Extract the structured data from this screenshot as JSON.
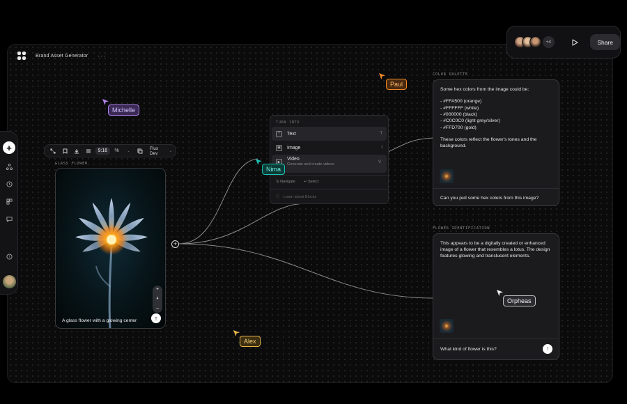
{
  "app": {
    "title": "Brand Asset Generator",
    "more": "···"
  },
  "share_bar": {
    "extra_count": "+4",
    "share_label": "Share"
  },
  "toolbar": {
    "aspect_ratio": "9:16",
    "percent_symbol": "%",
    "model": "Flux Dev"
  },
  "flower_node": {
    "label": "GLASS FLOWER",
    "caption": "A glass flower with a glowing center",
    "zoom_in": "+",
    "zoom_level": "4",
    "zoom_out": "−"
  },
  "turn_into": {
    "heading": "TURN INTO",
    "items": [
      {
        "label": "Text",
        "key": "T",
        "icon": "text-icon"
      },
      {
        "label": "Image",
        "key": "I",
        "icon": "image-icon"
      }
    ],
    "video": {
      "label": "Video",
      "sub": "Generate and create videos",
      "key": "V",
      "icon": "video-icon"
    },
    "navigate": "⇅ Navigate",
    "select": "↵ Select",
    "learn": "Learn about Blocks"
  },
  "color_palette": {
    "label": "COLOR PALETTE",
    "intro": "Some hex colors from the image could be:",
    "colors": [
      "- #FFA500 (orange)",
      "- #FFFFFF (white)",
      "- #000000 (black)",
      "- #C0C0C0 (light grey/silver)",
      "- #FFD700 (gold)"
    ],
    "outro": "These colors reflect the flower's tones and the background.",
    "question": "Can you pull some hex colors from this image?"
  },
  "flower_id": {
    "label": "FLOWER IDENTIFICATION",
    "answer": "This appears to be a digitally created or enhanced image of a flower that resembles a lotus. The design features glowing and translucent elements.",
    "question": "What kind of flower is this?"
  },
  "cursors": [
    {
      "name": "Michelle",
      "color": "#b184f0",
      "bg": "#3a2a55",
      "text": "#d8c2ff"
    },
    {
      "name": "Paul",
      "color": "#f08a24",
      "bg": "#4a2a10",
      "text": "#ffb866"
    },
    {
      "name": "Nima",
      "color": "#19c3b4",
      "bg": "#0c3c38",
      "text": "#6ef0e2"
    },
    {
      "name": "Orpheas",
      "color": "#f4f4f4",
      "bg": "#2c2c30",
      "text": "#f4f4f4"
    },
    {
      "name": "Alex",
      "color": "#e8b64a",
      "bg": "#3c2e10",
      "text": "#f3cf7a"
    }
  ],
  "accent": "#ffffff"
}
